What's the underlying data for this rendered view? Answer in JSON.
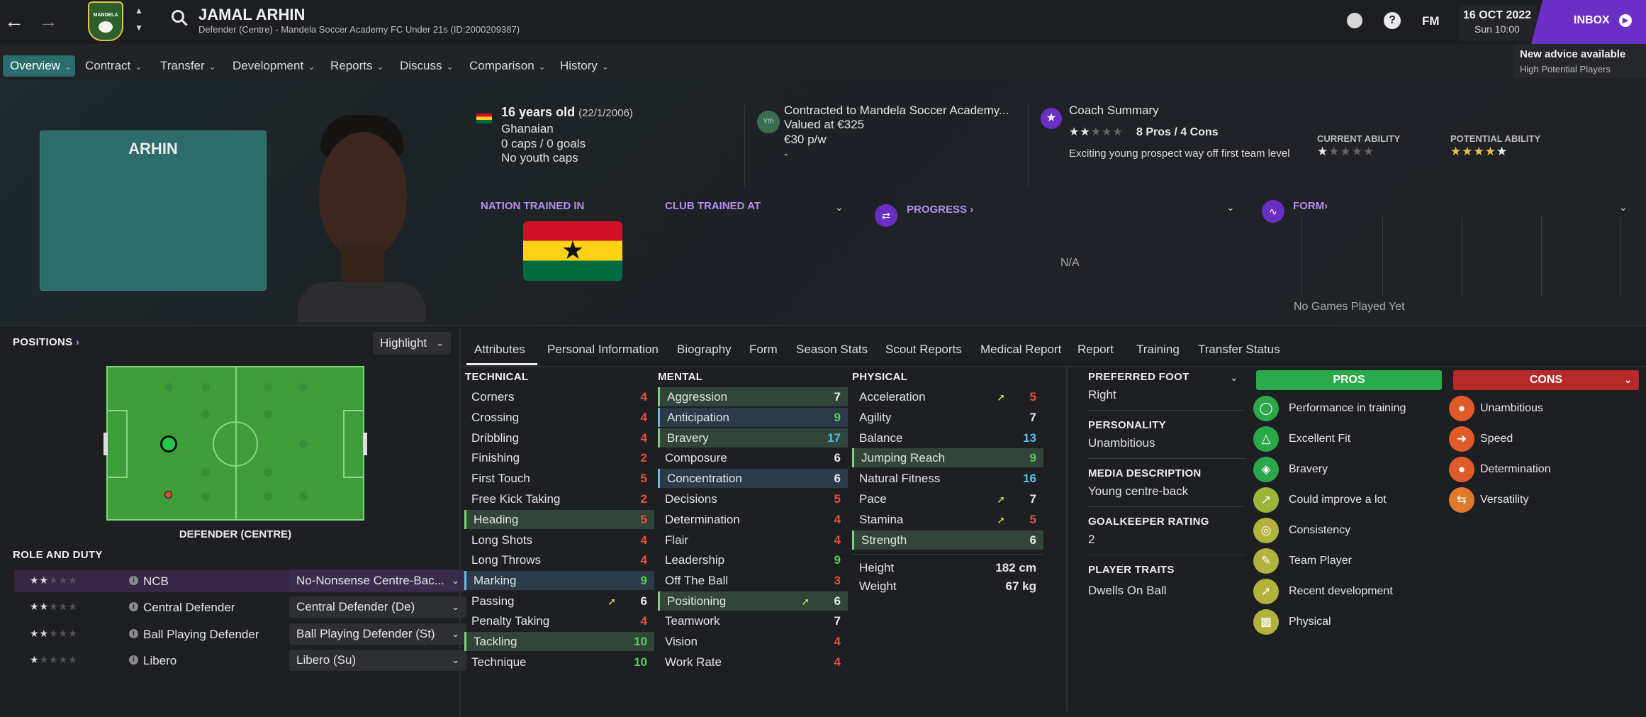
{
  "header": {
    "player_name": "JAMAL ARHIN",
    "player_sub": "Defender (Centre) - Mandela Soccer Academy FC Under 21s (ID:2000209387)",
    "fm_label": "FM",
    "date": "16 OCT 2022",
    "time": "Sun 10:00",
    "inbox_label": "INBOX",
    "advice_title": "New advice available",
    "advice_sub": "High Potential Players",
    "badge_text": "MANDELA"
  },
  "nav": [
    "Overview",
    "Contract",
    "Transfer",
    "Development",
    "Reports",
    "Discuss",
    "Comparison",
    "History"
  ],
  "hero": {
    "shirt_name": "ARHIN",
    "age": "16 years old",
    "dob": "(22/1/2006)",
    "nationality": "Ghanaian",
    "caps": "0 caps / 0 goals",
    "youth_caps": "No youth caps",
    "yth_badge": "Yth",
    "contract": "Contracted to Mandela Soccer Academy...",
    "value": "Valued at €325",
    "wage": "€30 p/w",
    "wage_dash": "-",
    "coach_title": "Coach Summary",
    "pros_cons": "8 Pros / 4 Cons",
    "coach_text": "Exciting young prospect way off first team level",
    "current_ability_label": "CURRENT ABILITY",
    "potential_ability_label": "POTENTIAL ABILITY",
    "current_ability_stars": 1,
    "potential_ability_stars": 4.5,
    "coach_stars": 2,
    "nation_trained_label": "NATION TRAINED IN",
    "club_trained_label": "CLUB TRAINED AT",
    "progress_label": "PROGRESS",
    "progress_value": "N/A",
    "form_label": "FORM",
    "form_empty": "No Games Played Yet"
  },
  "positions": {
    "title": "POSITIONS",
    "highlight_label": "Highlight",
    "position_name": "DEFENDER (CENTRE)",
    "role_title": "ROLE AND DUTY",
    "roles": [
      {
        "stars": 2,
        "name": "NCB",
        "duty": "No-Nonsense Centre-Bac..."
      },
      {
        "stars": 2,
        "name": "Central Defender",
        "duty": "Central Defender (De)"
      },
      {
        "stars": 2,
        "name": "Ball Playing Defender",
        "duty": "Ball Playing Defender (St)"
      },
      {
        "stars": 1,
        "name": "Libero",
        "duty": "Libero (Su)"
      }
    ]
  },
  "tabs": [
    "Attributes",
    "Personal Information",
    "Biography",
    "Form",
    "Season Stats",
    "Scout Reports",
    "Medical Report",
    "Report",
    "Training",
    "Transfer Status"
  ],
  "attributes": {
    "technical_title": "TECHNICAL",
    "mental_title": "MENTAL",
    "physical_title": "PHYSICAL",
    "technical": [
      {
        "name": "Corners",
        "value": "4"
      },
      {
        "name": "Crossing",
        "value": "4"
      },
      {
        "name": "Dribbling",
        "value": "4"
      },
      {
        "name": "Finishing",
        "value": "2"
      },
      {
        "name": "First Touch",
        "value": "5"
      },
      {
        "name": "Free Kick Taking",
        "value": "2"
      },
      {
        "name": "Heading",
        "value": "5"
      },
      {
        "name": "Long Shots",
        "value": "4"
      },
      {
        "name": "Long Throws",
        "value": "4"
      },
      {
        "name": "Marking",
        "value": "9"
      },
      {
        "name": "Passing",
        "value": "6"
      },
      {
        "name": "Penalty Taking",
        "value": "4"
      },
      {
        "name": "Tackling",
        "value": "10"
      },
      {
        "name": "Technique",
        "value": "10"
      }
    ],
    "mental": [
      {
        "name": "Aggression",
        "value": "7"
      },
      {
        "name": "Anticipation",
        "value": "9"
      },
      {
        "name": "Bravery",
        "value": "17"
      },
      {
        "name": "Composure",
        "value": "6"
      },
      {
        "name": "Concentration",
        "value": "6"
      },
      {
        "name": "Decisions",
        "value": "5"
      },
      {
        "name": "Determination",
        "value": "4"
      },
      {
        "name": "Flair",
        "value": "4"
      },
      {
        "name": "Leadership",
        "value": "9"
      },
      {
        "name": "Off The Ball",
        "value": "3"
      },
      {
        "name": "Positioning",
        "value": "6"
      },
      {
        "name": "Teamwork",
        "value": "7"
      },
      {
        "name": "Vision",
        "value": "4"
      },
      {
        "name": "Work Rate",
        "value": "4"
      }
    ],
    "physical": [
      {
        "name": "Acceleration",
        "value": "5"
      },
      {
        "name": "Agility",
        "value": "7"
      },
      {
        "name": "Balance",
        "value": "13"
      },
      {
        "name": "Jumping Reach",
        "value": "9"
      },
      {
        "name": "Natural Fitness",
        "value": "16"
      },
      {
        "name": "Pace",
        "value": "7"
      },
      {
        "name": "Stamina",
        "value": "5"
      },
      {
        "name": "Strength",
        "value": "6"
      }
    ],
    "height_label": "Height",
    "height": "182 cm",
    "weight_label": "Weight",
    "weight": "67 kg"
  },
  "profile": {
    "pref_foot_label": "PREFERRED FOOT",
    "pref_foot": "Right",
    "personality_label": "PERSONALITY",
    "personality": "Unambitious",
    "media_label": "MEDIA DESCRIPTION",
    "media": "Young centre-back",
    "gk_label": "GOALKEEPER RATING",
    "gk": "2",
    "traits_label": "PLAYER TRAITS",
    "traits": "Dwells On Ball"
  },
  "pros_label": "PROS",
  "cons_label": "CONS",
  "pros": [
    "Performance in training",
    "Excellent Fit",
    "Bravery",
    "Could improve a lot",
    "Consistency",
    "Team Player",
    "Recent development",
    "Physical"
  ],
  "cons": [
    "Unambitious",
    "Speed",
    "Determination",
    "Versatility"
  ],
  "colors": {
    "accent": "#7b2fd6",
    "pros": "#2aa84a",
    "cons": "#b62a2a",
    "pitch": "#3f9e3a"
  }
}
